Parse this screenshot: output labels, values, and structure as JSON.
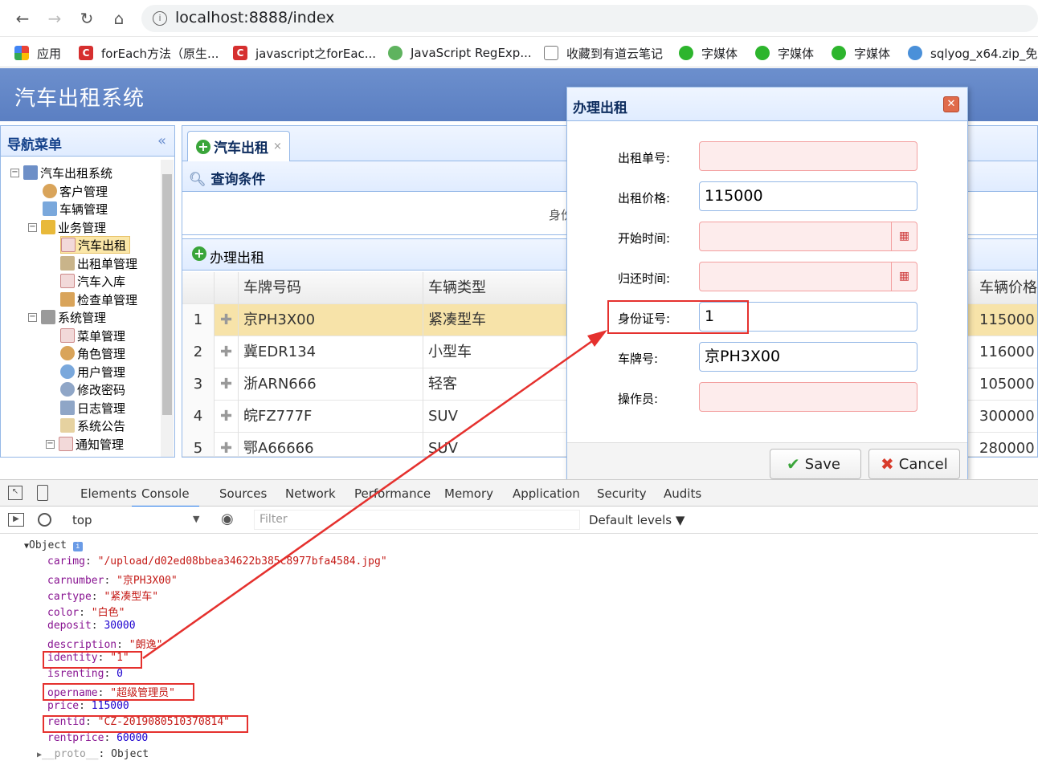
{
  "browser": {
    "url": "localhost:8888/index",
    "bookmarks": [
      {
        "label": "应用",
        "icon": "apps-grid-icon"
      },
      {
        "label": "forEach方法（原生...",
        "icon": "csdn-icon"
      },
      {
        "label": "javascript之forEac...",
        "icon": "csdn-icon"
      },
      {
        "label": "JavaScript RegExp...",
        "icon": "runoob-icon"
      },
      {
        "label": "收藏到有道云笔记",
        "icon": "page-icon"
      },
      {
        "label": "字媒体",
        "icon": "wechat-icon"
      },
      {
        "label": "字媒体",
        "icon": "wechat-icon"
      },
      {
        "label": "字媒体",
        "icon": "wechat-icon"
      },
      {
        "label": "sqlyog_x64.zip_免...",
        "icon": "download-icon"
      }
    ]
  },
  "app": {
    "title": "汽车出租系统"
  },
  "nav": {
    "title": "导航菜单",
    "items": [
      {
        "label": "汽车出租系统"
      },
      {
        "label": "客户管理"
      },
      {
        "label": "车辆管理"
      },
      {
        "label": "业务管理"
      },
      {
        "label": "汽车出租"
      },
      {
        "label": "出租单管理"
      },
      {
        "label": "汽车入库"
      },
      {
        "label": "检查单管理"
      },
      {
        "label": "系统管理"
      },
      {
        "label": "菜单管理"
      },
      {
        "label": "角色管理"
      },
      {
        "label": "用户管理"
      },
      {
        "label": "修改密码"
      },
      {
        "label": "日志管理"
      },
      {
        "label": "系统公告"
      },
      {
        "label": "通知管理"
      }
    ]
  },
  "main": {
    "tab": "汽车出租",
    "query_title": "查询条件",
    "query_partial": "身份",
    "grid_title": "办理出租",
    "columns": {
      "carnumber": "车牌号码",
      "cartype": "车辆类型",
      "price": "车辆价格"
    },
    "rows": [
      {
        "no": "1",
        "carnumber": "京PH3X00",
        "cartype": "紧凑型车",
        "price": "115000"
      },
      {
        "no": "2",
        "carnumber": "冀EDR134",
        "cartype": "小型车",
        "price": "116000"
      },
      {
        "no": "3",
        "carnumber": "浙ARN666",
        "cartype": "轻客",
        "price": "105000"
      },
      {
        "no": "4",
        "carnumber": "皖FZ777F",
        "cartype": "SUV",
        "price": "300000"
      },
      {
        "no": "5",
        "carnumber": "鄂A66666",
        "cartype": "SUV",
        "price": "280000"
      }
    ]
  },
  "dialog": {
    "title": "办理出租",
    "fields": [
      {
        "label": "出租单号:",
        "value": ""
      },
      {
        "label": "出租价格:",
        "value": "115000"
      },
      {
        "label": "开始时间:",
        "value": ""
      },
      {
        "label": "归还时间:",
        "value": ""
      },
      {
        "label": "身份证号:",
        "value": "1"
      },
      {
        "label": "车牌号:",
        "value": "京PH3X00"
      },
      {
        "label": "操作员:",
        "value": ""
      }
    ],
    "save": "Save",
    "cancel": "Cancel"
  },
  "devtools": {
    "tabs": [
      "Elements",
      "Console",
      "Sources",
      "Network",
      "Performance",
      "Memory",
      "Application",
      "Security",
      "Audits"
    ],
    "context": "top",
    "filter_placeholder": "Filter",
    "levels": "Default levels ▼",
    "object_label": "Object",
    "props": [
      {
        "key": "carimg",
        "value": "\"/upload/d02ed08bbea34622b385c8977bfa4584.jpg\"",
        "type": "string"
      },
      {
        "key": "carnumber",
        "value": "\"京PH3X00\"",
        "type": "string"
      },
      {
        "key": "cartype",
        "value": "\"紧凑型车\"",
        "type": "string"
      },
      {
        "key": "color",
        "value": "\"白色\"",
        "type": "string"
      },
      {
        "key": "deposit",
        "value": "30000",
        "type": "number"
      },
      {
        "key": "description",
        "value": "\"朗逸\"",
        "type": "string"
      },
      {
        "key": "identity",
        "value": "\"1\"",
        "type": "string"
      },
      {
        "key": "isrenting",
        "value": "0",
        "type": "number"
      },
      {
        "key": "opername",
        "value": "\"超级管理员\"",
        "type": "string"
      },
      {
        "key": "price",
        "value": "115000",
        "type": "number"
      },
      {
        "key": "rentid",
        "value": "\"CZ-2019080510370814\"",
        "type": "string"
      },
      {
        "key": "rentprice",
        "value": "60000",
        "type": "number"
      }
    ],
    "proto": "__proto__",
    "proto_value": "Object"
  },
  "colors": {
    "header": "#5b7fc2",
    "panel_border": "#95b8e7",
    "selected_row": "#f7e3a9",
    "annotation": "#e5312e"
  }
}
